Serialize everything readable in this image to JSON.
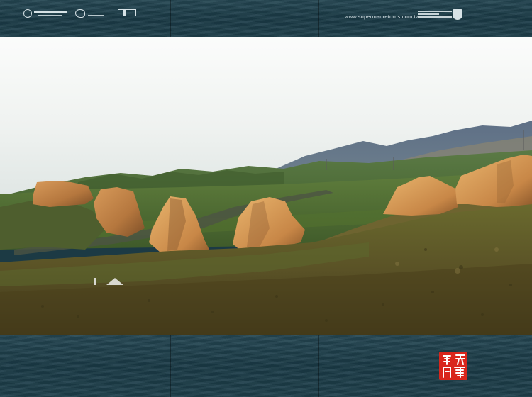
{
  "header": {
    "website": "www.supermanreturns.com.tw"
  },
  "colors": {
    "band": "#1f404b",
    "sky": "#f4f5f4",
    "seal": "#d9261c"
  },
  "icons": [
    "legendary-logo-icon",
    "studio-swirl-logo-icon",
    "box-logo-icon",
    "warner-bros-shield-icon",
    "red-seal-icon"
  ]
}
